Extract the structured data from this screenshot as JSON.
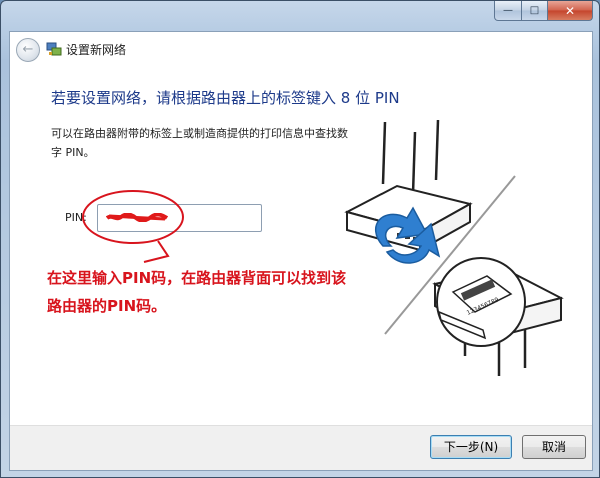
{
  "window": {
    "title": "设置新网络",
    "caption": {
      "minimize": "—",
      "maximize": "□",
      "close": "✕"
    }
  },
  "nav": {
    "back_icon": "back-arrow-icon",
    "title_icon": "network-icon"
  },
  "content": {
    "heading": "若要设置网络，请根据路由器上的标签键入 8 位 PIN",
    "instructions": "可以在路由器附带的标签上或制造商提供的打印信息中查找数字 PIN。",
    "pin_label": "PIN:",
    "pin_value": ""
  },
  "annotation": {
    "text": "在这里输入PIN码，在路由器背面可以找到该路由器的PIN码。",
    "color": "#d8141d"
  },
  "illustration": {
    "label_text": "123456789"
  },
  "footer": {
    "next_label": "下一步(N)",
    "cancel_label": "取消"
  },
  "colors": {
    "heading": "#1d3a8a",
    "arrow_blue": "#2f7fd0"
  }
}
